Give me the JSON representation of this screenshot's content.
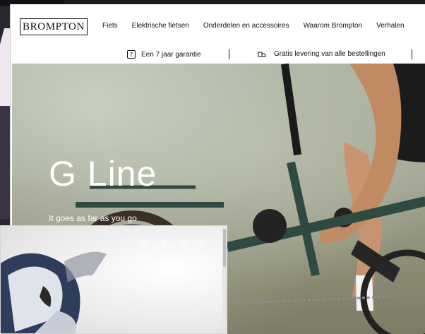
{
  "brand": {
    "logo_text": "BROMPTON"
  },
  "nav": {
    "links": [
      {
        "label": "Fiets"
      },
      {
        "label": "Elektrische fietsen"
      },
      {
        "label": "Onderdelen en accessoires"
      },
      {
        "label": "Waarom Brompton"
      },
      {
        "label": "Verhalen"
      }
    ]
  },
  "infobar": {
    "guarantee_badge": "7",
    "guarantee": "Een 7 jaar garantie",
    "delivery": "Gratis levering van alle bestellingen"
  },
  "hero": {
    "title": "G Line",
    "subtitle": "It goes as far as you go"
  },
  "overlay": {
    "icons": [
      "search-icon",
      "user-icon",
      "bag-icon",
      "menu-icon"
    ]
  },
  "colors": {
    "text": "#111111",
    "hero_text": "#ffffff",
    "frame": "#2f4a40"
  }
}
